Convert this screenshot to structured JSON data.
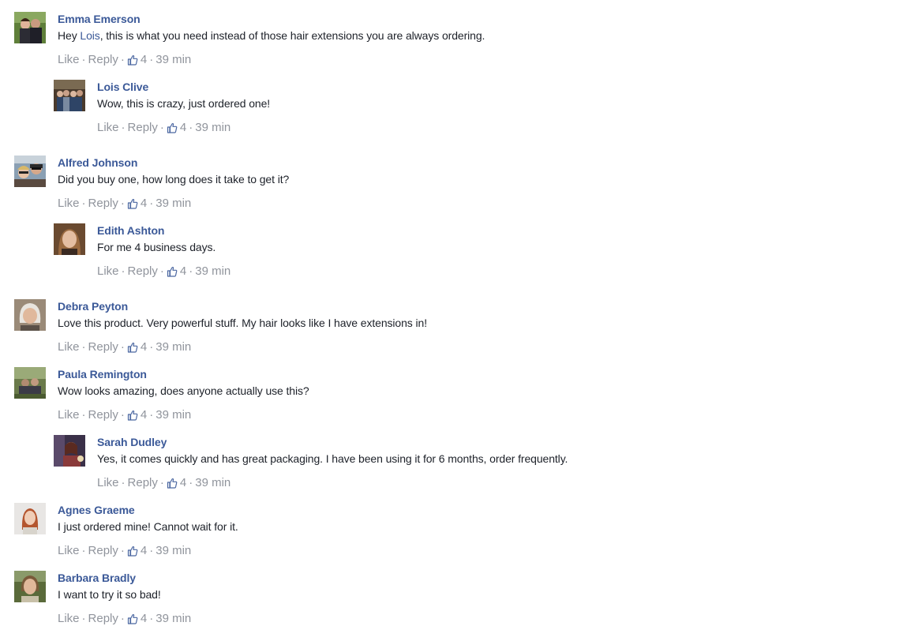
{
  "colors": {
    "name": "#3b5998",
    "text": "#1d2129",
    "meta": "#90949c",
    "like_icon": "#4b67a1"
  },
  "icons": {
    "like": "thumbs-up-icon"
  },
  "comments": [
    {
      "name": "Emma Emerson",
      "text_prefix": "Hey ",
      "mention": "Lois",
      "text": ", this is what you need instead of those hair extensions you are always ordering.",
      "like_label": "Like",
      "reply_label": "Reply",
      "likes": "4",
      "time": "39 min",
      "reply": false
    },
    {
      "name": "Lois Clive",
      "text_prefix": "",
      "mention": "",
      "text": "Wow, this is crazy, just ordered one!",
      "like_label": "Like",
      "reply_label": "Reply",
      "likes": "4",
      "time": "39 min",
      "reply": true
    },
    {
      "name": "Alfred Johnson",
      "text_prefix": "",
      "mention": "",
      "text": "Did you buy one, how long does it take to get it?",
      "like_label": "Like",
      "reply_label": "Reply",
      "likes": "4",
      "time": "39 min",
      "reply": false
    },
    {
      "name": "Edith Ashton",
      "text_prefix": "",
      "mention": "",
      "text": "For me 4 business days.",
      "like_label": "Like",
      "reply_label": "Reply",
      "likes": "4",
      "time": "39 min",
      "reply": true
    },
    {
      "name": "Debra Peyton",
      "text_prefix": "",
      "mention": "",
      "text": "Love this product. Very powerful stuff. My hair looks like I have extensions in!",
      "like_label": "Like",
      "reply_label": "Reply",
      "likes": "4",
      "time": "39 min",
      "reply": false
    },
    {
      "name": "Paula Remington",
      "text_prefix": "",
      "mention": "",
      "text": "Wow looks amazing, does anyone actually use this?",
      "like_label": "Like",
      "reply_label": "Reply",
      "likes": "4",
      "time": "39 min",
      "reply": false
    },
    {
      "name": "Sarah Dudley",
      "text_prefix": "",
      "mention": "",
      "text": "Yes, it comes quickly and has great packaging. I have been using it for 6 months, order frequently.",
      "like_label": "Like",
      "reply_label": "Reply",
      "likes": "4",
      "time": "39 min",
      "reply": true
    },
    {
      "name": "Agnes Graeme",
      "text_prefix": "",
      "mention": "",
      "text": "I just ordered mine! Cannot wait for it.",
      "like_label": "Like",
      "reply_label": "Reply",
      "likes": "4",
      "time": "39 min",
      "reply": false
    },
    {
      "name": "Barbara Bradly",
      "text_prefix": "",
      "mention": "",
      "text": "I want to try it so bad!",
      "like_label": "Like",
      "reply_label": "Reply",
      "likes": "4",
      "time": "39 min",
      "reply": false
    }
  ]
}
